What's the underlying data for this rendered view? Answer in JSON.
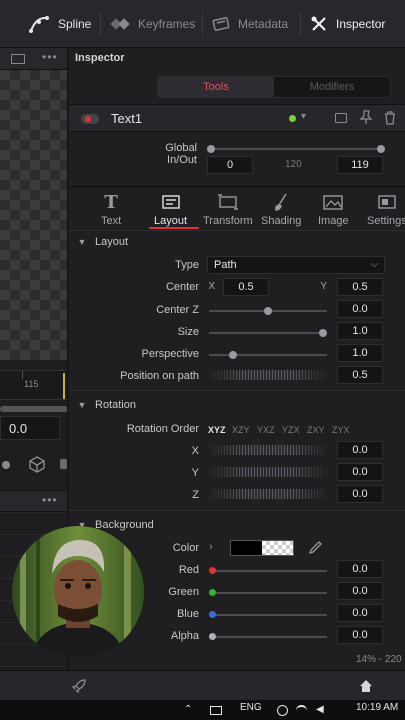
{
  "top_tabs": [
    {
      "label": "Spline",
      "icon": "spline-icon"
    },
    {
      "label": "Keyframes",
      "icon": "keyframes-icon"
    },
    {
      "label": "Metadata",
      "icon": "metadata-icon"
    },
    {
      "label": "Inspector",
      "icon": "inspector-icon"
    }
  ],
  "viewer": {
    "ruler_label": "115",
    "value": "0.0"
  },
  "inspector": {
    "title": "Inspector",
    "segments": [
      "Tools",
      "Modifiers"
    ],
    "node_name": "Text1",
    "global_in_out": {
      "label": "Global In/Out",
      "in": "0",
      "mid": "120",
      "out": "119"
    },
    "tabs": [
      {
        "label": "Text",
        "icon": "text-tab-icon"
      },
      {
        "label": "Layout",
        "icon": "layout-tab-icon"
      },
      {
        "label": "Transform",
        "icon": "transform-tab-icon"
      },
      {
        "label": "Shading",
        "icon": "shading-tab-icon"
      },
      {
        "label": "Image",
        "icon": "image-tab-icon"
      },
      {
        "label": "Settings",
        "icon": "settings-tab-icon"
      }
    ],
    "layout": {
      "section": "Layout",
      "type_label": "Type",
      "type_value": "Path",
      "center_label": "Center",
      "x_label": "X",
      "x_value": "0.5",
      "y_label": "Y",
      "y_value": "0.5",
      "center_z_label": "Center Z",
      "center_z_value": "0.0",
      "size_label": "Size",
      "size_value": "1.0",
      "perspective_label": "Perspective",
      "perspective_value": "1.0",
      "position_label": "Position on path",
      "position_value": "0.5"
    },
    "rotation": {
      "section": "Rotation",
      "order_label": "Rotation Order",
      "orders": [
        "XYZ",
        "XZY",
        "YXZ",
        "YZX",
        "ZXY",
        "ZYX"
      ],
      "x_label": "X",
      "x_value": "0.0",
      "y_label": "Y",
      "y_value": "0.0",
      "z_label": "Z",
      "z_value": "0.0"
    },
    "background": {
      "section": "Background",
      "color_label": "Color",
      "red_label": "Red",
      "red_value": "0.0",
      "green_label": "Green",
      "green_value": "0.0",
      "blue_label": "Blue",
      "blue_value": "0.0",
      "alpha_label": "Alpha",
      "alpha_value": "0.0"
    },
    "zoom": "14% - 220"
  },
  "taskbar": {
    "lang": "ENG",
    "time": "10:19 AM"
  },
  "colors": {
    "accent_red": "#e2303a",
    "status_green": "#7bd13a"
  }
}
